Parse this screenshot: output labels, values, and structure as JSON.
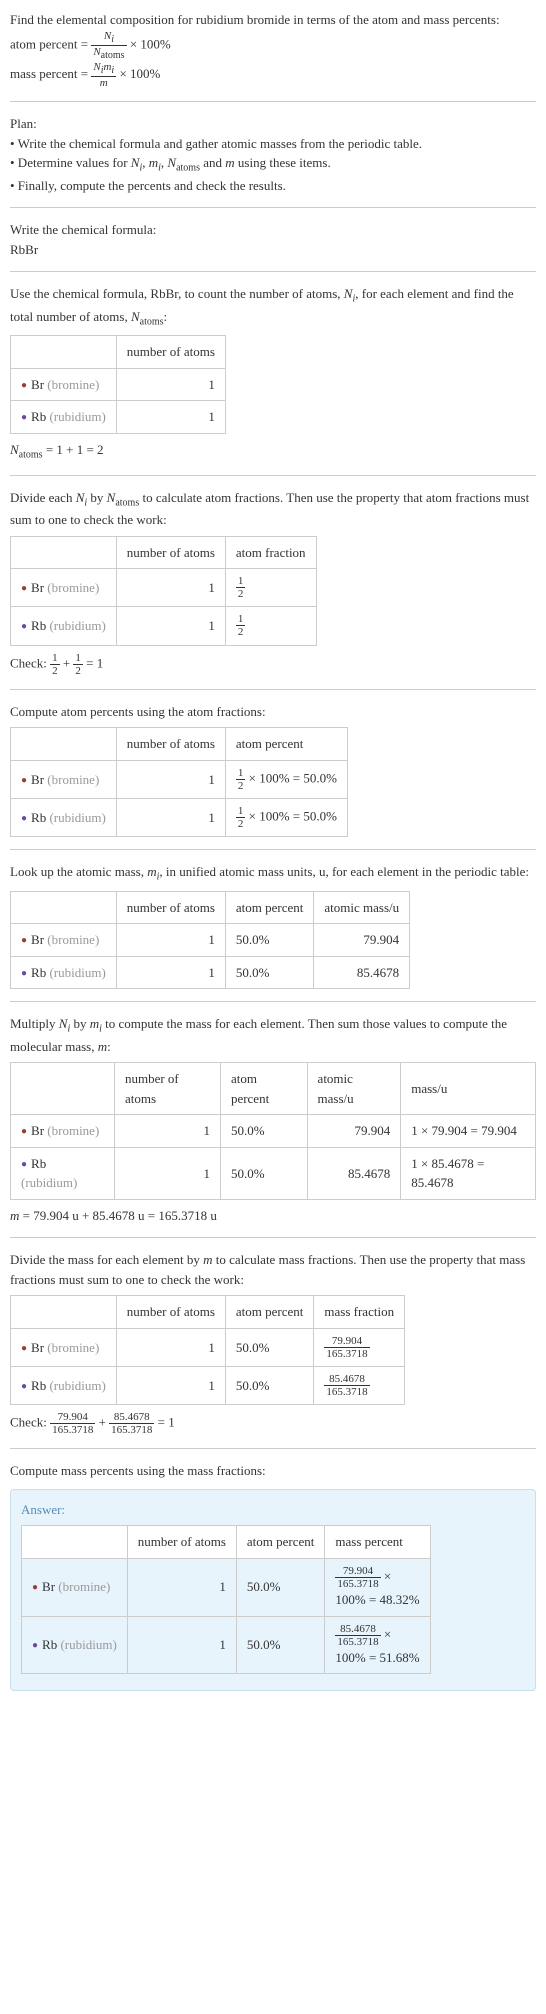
{
  "intro": {
    "line1": "Find the elemental composition for rubidium bromide in terms of the atom and mass percents:",
    "atom_percent_lhs": "atom percent = ",
    "atom_percent_frac_n": "N_i",
    "atom_percent_frac_d": "N_atoms",
    "times100": " × 100%",
    "mass_percent_lhs": "mass percent = ",
    "mass_percent_frac_n": "N_i m_i",
    "mass_percent_frac_d": "m"
  },
  "plan": {
    "header": "Plan:",
    "b1": "• Write the chemical formula and gather atomic masses from the periodic table.",
    "b2_a": "• Determine values for ",
    "b2_b": " using these items.",
    "b3": "• Finally, compute the percents and check the results."
  },
  "step_formula": {
    "header": "Write the chemical formula:",
    "formula": "RbBr"
  },
  "step_count": {
    "line_a": "Use the chemical formula, RbBr, to count the number of atoms, ",
    "line_b": ", for each element and find the total number of atoms, ",
    "line_c": ":",
    "col1": "number of atoms",
    "br_label": "Br",
    "br_paren": " (bromine)",
    "rb_label": "Rb",
    "rb_paren": " (rubidium)",
    "br_n": "1",
    "rb_n": "1",
    "total_lhs": "N_atoms",
    "total_eq": " = 1 + 1 = 2"
  },
  "step_atomfrac": {
    "line": "Divide each N_i by N_atoms to calculate atom fractions. Then use the property that atom fractions must sum to one to check the work:",
    "col1": "number of atoms",
    "col2": "atom fraction",
    "br_n": "1",
    "rb_n": "1",
    "half_n": "1",
    "half_d": "2",
    "check_label": "Check: ",
    "check_eq": " = 1"
  },
  "step_atompct": {
    "line": "Compute atom percents using the atom fractions:",
    "col1": "number of atoms",
    "col2": "atom percent",
    "br_n": "1",
    "rb_n": "1",
    "pct_eq": " × 100% = 50.0%"
  },
  "step_mass": {
    "line_a": "Look up the atomic mass, ",
    "line_b": ", in unified atomic mass units, u, for each element in the periodic table:",
    "col1": "number of atoms",
    "col2": "atom percent",
    "col3": "atomic mass/u",
    "br_n": "1",
    "br_pct": "50.0%",
    "br_mass": "79.904",
    "rb_n": "1",
    "rb_pct": "50.0%",
    "rb_mass": "85.4678"
  },
  "step_mult": {
    "line_a": "Multiply ",
    "line_b": " by ",
    "line_c": " to compute the mass for each element. Then sum those values to compute the molecular mass, ",
    "line_d": ":",
    "col1": "number of atoms",
    "col2": "atom percent",
    "col3": "atomic mass/u",
    "col4": "mass/u",
    "br_n": "1",
    "br_pct": "50.0%",
    "br_mass": "79.904",
    "br_calc": "1 × 79.904 = 79.904",
    "rb_n": "1",
    "rb_pct": "50.0%",
    "rb_mass": "85.4678",
    "rb_calc": "1 × 85.4678 = 85.4678",
    "m_eq": "m = 79.904 u + 85.4678 u = 165.3718 u"
  },
  "step_massfrac": {
    "line": "Divide the mass for each element by m to calculate mass fractions. Then use the property that mass fractions must sum to one to check the work:",
    "col1": "number of atoms",
    "col2": "atom percent",
    "col3": "mass fraction",
    "br_n": "1",
    "br_pct": "50.0%",
    "br_frac_n": "79.904",
    "br_frac_d": "165.3718",
    "rb_n": "1",
    "rb_pct": "50.0%",
    "rb_frac_n": "85.4678",
    "rb_frac_d": "165.3718",
    "check_label": "Check: ",
    "check_eq": " = 1"
  },
  "final": {
    "line": "Compute mass percents using the mass fractions:",
    "answer_label": "Answer:",
    "col1": "number of atoms",
    "col2": "atom percent",
    "col3": "mass percent",
    "br_n": "1",
    "br_pct": "50.0%",
    "br_frac_n": "79.904",
    "br_frac_d": "165.3718",
    "br_result": "100% = 48.32%",
    "rb_n": "1",
    "rb_pct": "50.0%",
    "rb_frac_n": "85.4678",
    "rb_frac_d": "165.3718",
    "rb_result": "100% = 51.68%"
  }
}
